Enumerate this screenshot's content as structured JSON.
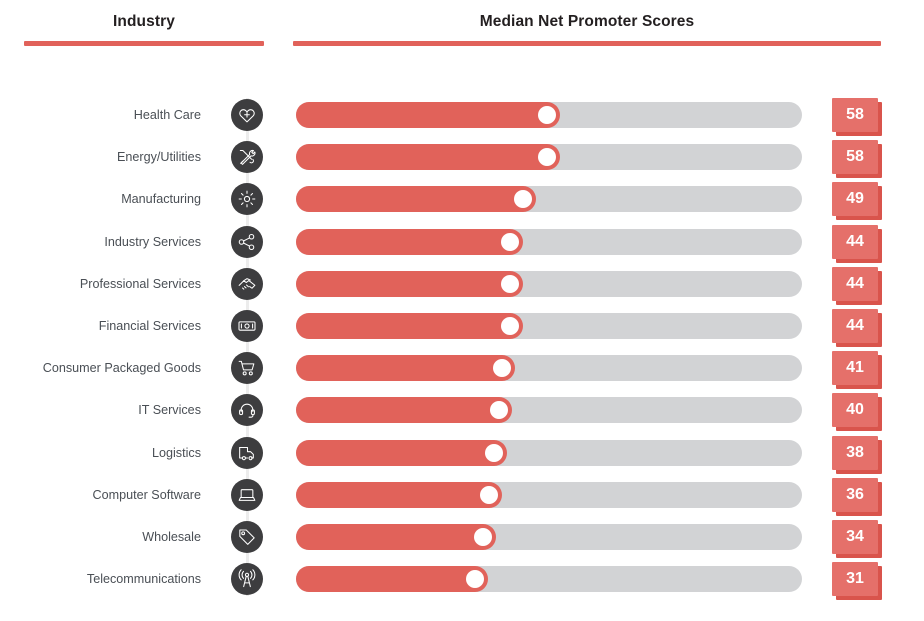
{
  "header": {
    "industry_label": "Industry",
    "scores_label": "Median Net Promoter Scores",
    "rule_color": "#e1625a"
  },
  "colors": {
    "bar_fill": "#e1625a",
    "bar_track": "#d2d3d5",
    "icon_circle": "#3d3d3f",
    "badge_face": "#e5706a",
    "badge_shadow": "#d9544c",
    "label_text": "#4a4f55",
    "knob": "#ffffff"
  },
  "chart_data": {
    "type": "bar",
    "title": "Median Net Promoter Scores",
    "xlabel": "",
    "ylabel": "Industry",
    "xlim": [
      0,
      100
    ],
    "grid": false,
    "legend": "none",
    "categories": [
      "Health Care",
      "Energy/Utilities",
      "Manufacturing",
      "Industry Services",
      "Professional Services",
      "Financial Services",
      "Consumer Packaged Goods",
      "IT Services",
      "Logistics",
      "Computer Software",
      "Wholesale",
      "Telecommunications"
    ],
    "values": [
      58,
      58,
      49,
      44,
      44,
      44,
      41,
      40,
      38,
      36,
      34,
      31
    ]
  },
  "rows": [
    {
      "label": "Health Care",
      "value": "58",
      "icon": "heart-plus-icon"
    },
    {
      "label": "Energy/Utilities",
      "value": "58",
      "icon": "tools-icon"
    },
    {
      "label": "Manufacturing",
      "value": "49",
      "icon": "gear-icon"
    },
    {
      "label": "Industry Services",
      "value": "44",
      "icon": "share-network-icon"
    },
    {
      "label": "Professional Services",
      "value": "44",
      "icon": "handshake-icon"
    },
    {
      "label": "Financial Services",
      "value": "44",
      "icon": "banknote-icon"
    },
    {
      "label": "Consumer Packaged Goods",
      "value": "41",
      "icon": "shopping-cart-icon"
    },
    {
      "label": "IT Services",
      "value": "40",
      "icon": "headset-icon"
    },
    {
      "label": "Logistics",
      "value": "38",
      "icon": "truck-icon"
    },
    {
      "label": "Computer Software",
      "value": "36",
      "icon": "laptop-icon"
    },
    {
      "label": "Wholesale",
      "value": "34",
      "icon": "price-tag-icon"
    },
    {
      "label": "Telecommunications",
      "value": "31",
      "icon": "broadcast-tower-icon"
    }
  ]
}
